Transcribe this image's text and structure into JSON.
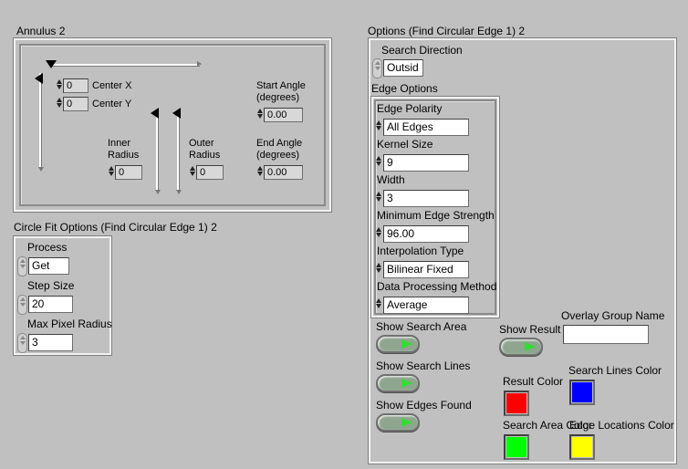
{
  "annulus": {
    "title": "Annulus 2",
    "center_x": {
      "label": "Center X",
      "value": "0"
    },
    "center_y": {
      "label": "Center Y",
      "value": "0"
    },
    "inner_radius": {
      "label": "Inner\nRadius",
      "value": "0"
    },
    "outer_radius": {
      "label": "Outer\nRadius",
      "value": "0"
    },
    "start_angle": {
      "label": "Start Angle\n(degrees)",
      "value": "0.00"
    },
    "end_angle": {
      "label": "End Angle\n(degrees)",
      "value": "0.00"
    }
  },
  "circle_fit": {
    "title": "Circle Fit Options (Find Circular Edge 1) 2",
    "process": {
      "label": "Process",
      "value": "Get"
    },
    "step_size": {
      "label": "Step Size",
      "value": "20"
    },
    "max_pixel_radius": {
      "label": "Max Pixel Radius",
      "value": "3"
    }
  },
  "options": {
    "title": "Options (Find Circular Edge 1) 2",
    "search_direction": {
      "label": "Search  Direction",
      "value": "Outsid"
    },
    "edge_options_title": "Edge Options",
    "edge_polarity": {
      "label": "Edge Polarity",
      "value": "All Edges"
    },
    "kernel_size": {
      "label": "Kernel Size",
      "value": "9"
    },
    "width": {
      "label": "Width",
      "value": "3"
    },
    "min_edge_strength": {
      "label": "Minimum Edge Strength",
      "value": "96.00"
    },
    "interpolation_type": {
      "label": "Interpolation Type",
      "value": "Bilinear Fixed"
    },
    "data_processing_method": {
      "label": "Data Processing Method",
      "value": "Average"
    },
    "show_search_area": "Show Search Area",
    "show_search_lines": "Show Search Lines",
    "show_edges_found": "Show Edges Found",
    "show_result": "Show Result",
    "overlay_group_name": {
      "label": "Overlay Group Name",
      "value": ""
    },
    "result_color": {
      "label": "Result Color",
      "color": "#ff0000"
    },
    "search_lines_color": {
      "label": "Search Lines Color",
      "color": "#0000ff"
    },
    "search_area_color": {
      "label": "Search Area Color",
      "color": "#00ff00"
    },
    "edge_locations_color": {
      "label": "Edge Locations Color",
      "color": "#ffff00"
    }
  }
}
